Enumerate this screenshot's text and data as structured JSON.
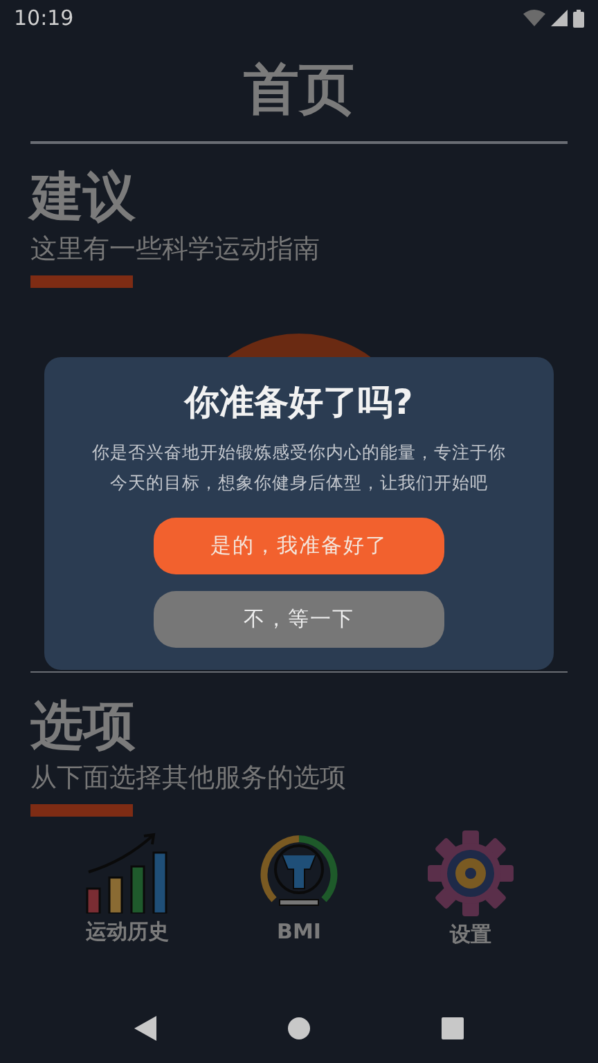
{
  "status_bar": {
    "time": "10:19"
  },
  "header": {
    "title": "首页"
  },
  "sections": [
    {
      "title": "建议",
      "subtitle": "这里有一些科学运动指南"
    },
    {
      "title": "选项",
      "subtitle": "从下面选择其他服务的选项"
    }
  ],
  "options": [
    {
      "kind": "history",
      "label": "运动历史"
    },
    {
      "kind": "bmi",
      "label": "BMI"
    },
    {
      "kind": "settings",
      "label": "设置"
    }
  ],
  "dialog": {
    "title": "你准备好了吗?",
    "message": "你是否兴奋地开始锻炼感受你内心的能量，专注于你今天的目标，想象你健身后体型，让我们开始吧",
    "buttons": [
      {
        "kind": "primary",
        "label": "是的，我准备好了"
      },
      {
        "kind": "secondary",
        "label": "不，等一下"
      }
    ]
  }
}
